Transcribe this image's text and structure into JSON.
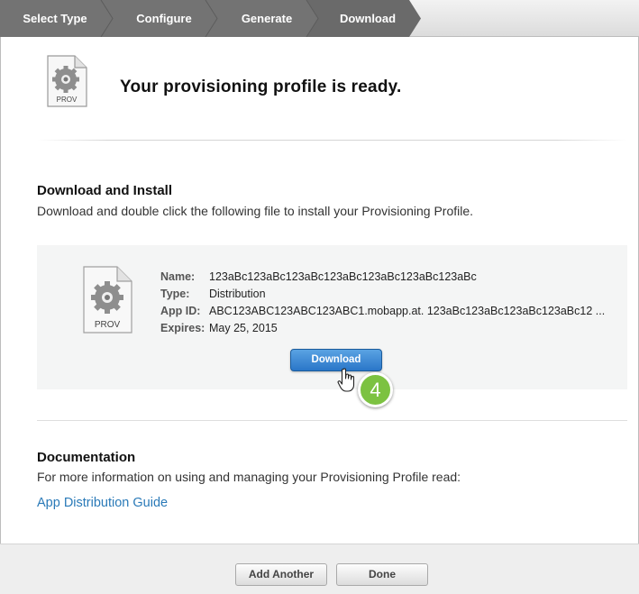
{
  "steps": [
    {
      "label": "Select Type"
    },
    {
      "label": "Configure"
    },
    {
      "label": "Generate"
    },
    {
      "label": "Download"
    }
  ],
  "header": {
    "title": "Your provisioning profile is ready.",
    "file_icon_label": "PROV"
  },
  "download_install": {
    "heading": "Download and Install",
    "description": "Download and double click the following file to install your Provisioning Profile."
  },
  "profile": {
    "icon_label": "PROV",
    "name_label": "Name:",
    "name_value": "123aBc123aBc123aBc123aBc123aBc123aBc123aBc",
    "type_label": "Type:",
    "type_value": "Distribution",
    "appid_label": "App ID:",
    "appid_value": "ABC123ABC123ABC123ABC1.mobapp.at. 123aBc123aBc123aBc123aBc12 ...",
    "expires_label": "Expires:",
    "expires_value": "May 25, 2015",
    "download_label": "Download"
  },
  "annotation": {
    "step_number": "4"
  },
  "documentation": {
    "heading": "Documentation",
    "description": "For more information on using and managing your Provisioning Profile read:",
    "link_label": "App Distribution Guide"
  },
  "footer": {
    "add_another_label": "Add Another",
    "done_label": "Done"
  },
  "colors": {
    "step_active": "#6e6e6e",
    "step_inactive": "#8c8c8c",
    "download_button": "#2f7fd0",
    "link": "#2a7ab8",
    "step_badge": "#7cc241"
  }
}
